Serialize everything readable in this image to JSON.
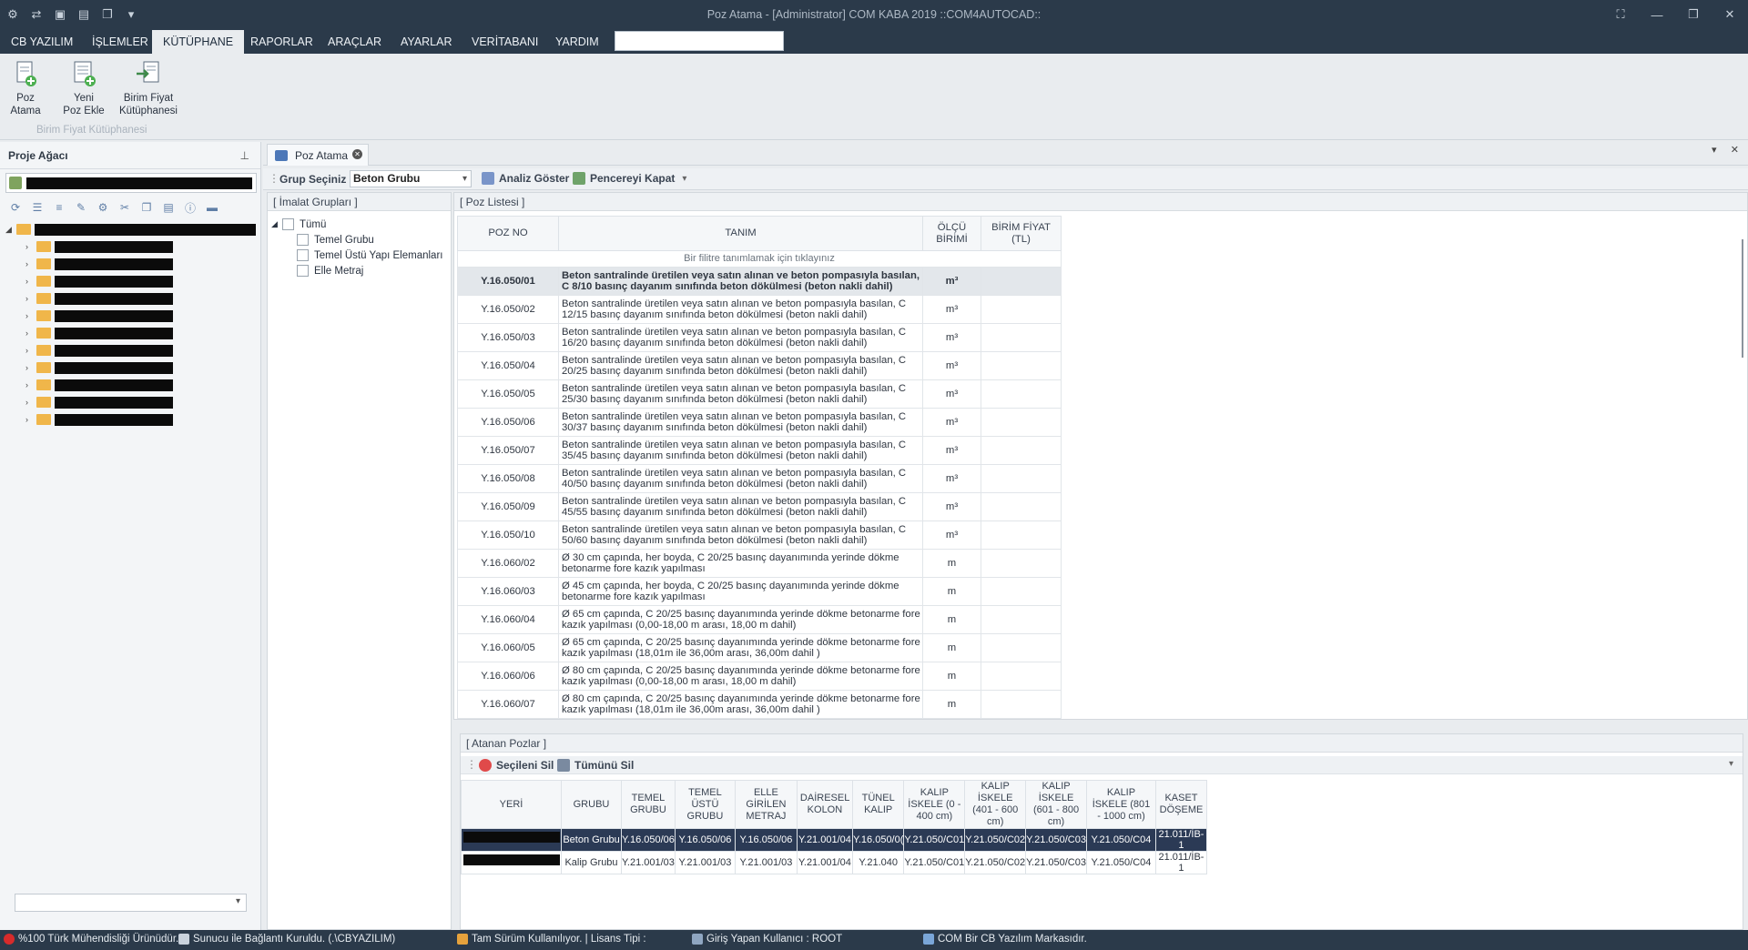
{
  "window": {
    "title": "Poz Atama - [Administrator] COM KABA 2019 ::COM4AUTOCAD::",
    "controls": [
      "⛶",
      "—",
      "❐",
      "✕"
    ]
  },
  "menu": {
    "items": [
      "CB YAZILIM",
      "İŞLEMLER",
      "KÜTÜPHANE",
      "RAPORLAR",
      "ARAÇLAR",
      "AYARLAR",
      "VERİTABANI",
      "YARDIM"
    ],
    "active": "KÜTÜPHANE",
    "search_value": ""
  },
  "ribbon": {
    "buttons": [
      {
        "line1": "Poz",
        "line2": "Atama"
      },
      {
        "line1": "Yeni",
        "line2": "Poz Ekle"
      },
      {
        "line1": "Birim Fiyat",
        "line2": "Kütüphanesi"
      }
    ],
    "group_caption": "Birim Fiyat Kütüphanesi"
  },
  "proje": {
    "title": "Proje Ağacı",
    "pin": "⊥"
  },
  "doc_tab": {
    "label": "Poz Atama",
    "close": "✕"
  },
  "group_toolbar": {
    "label": "Grup Seçiniz",
    "selected": "Beton Grubu",
    "analiz_label": "Analiz Göster",
    "kapat_label": "Pencereyi Kapat"
  },
  "imalat": {
    "title": "[ İmalat Grupları ]",
    "root": "Tümü",
    "items": [
      "Temel Grubu",
      "Temel Üstü Yapı Elemanları",
      "Elle Metraj"
    ]
  },
  "poz_list": {
    "title": "[ Poz Listesi ]",
    "headers": {
      "no": "POZ NO",
      "tanim": "TANIM",
      "birim": "ÖLÇÜ BİRİMİ",
      "fiyat": "BİRİM FİYAT (TL)"
    },
    "filter_hint": "Bir filitre tanımlamak için tıklayınız",
    "rows": [
      {
        "no": "Y.16.050/01",
        "tanim": "Beton santralinde üretilen veya satın alınan ve beton pompasıyla basılan, C 8/10 basınç dayanım sınıfında beton dökülmesi (beton nakli dahil)",
        "birim": "m³",
        "fiyat": ""
      },
      {
        "no": "Y.16.050/02",
        "tanim": "Beton santralinde üretilen veya satın alınan ve beton pompasıyla basılan, C 12/15 basınç dayanım sınıfında beton dökülmesi (beton nakli dahil)",
        "birim": "m³",
        "fiyat": ""
      },
      {
        "no": "Y.16.050/03",
        "tanim": "Beton santralinde üretilen veya satın alınan ve beton pompasıyla basılan, C 16/20 basınç dayanım sınıfında beton dökülmesi (beton nakli dahil)",
        "birim": "m³",
        "fiyat": ""
      },
      {
        "no": "Y.16.050/04",
        "tanim": "Beton santralinde üretilen veya satın alınan ve beton pompasıyla basılan, C 20/25 basınç dayanım sınıfında beton dökülmesi (beton nakli dahil)",
        "birim": "m³",
        "fiyat": ""
      },
      {
        "no": "Y.16.050/05",
        "tanim": "Beton santralinde üretilen veya satın alınan ve beton pompasıyla basılan, C 25/30 basınç dayanım sınıfında beton dökülmesi (beton nakli dahil)",
        "birim": "m³",
        "fiyat": ""
      },
      {
        "no": "Y.16.050/06",
        "tanim": "Beton santralinde üretilen veya satın alınan ve beton pompasıyla basılan, C 30/37 basınç dayanım sınıfında beton dökülmesi (beton nakli dahil)",
        "birim": "m³",
        "fiyat": ""
      },
      {
        "no": "Y.16.050/07",
        "tanim": "Beton santralinde üretilen veya satın alınan ve beton pompasıyla basılan, C 35/45 basınç dayanım sınıfında beton dökülmesi (beton nakli dahil)",
        "birim": "m³",
        "fiyat": ""
      },
      {
        "no": "Y.16.050/08",
        "tanim": "Beton santralinde üretilen veya satın alınan ve beton pompasıyla basılan, C 40/50 basınç dayanım sınıfında beton dökülmesi (beton nakli dahil)",
        "birim": "m³",
        "fiyat": ""
      },
      {
        "no": "Y.16.050/09",
        "tanim": "Beton santralinde üretilen veya satın alınan ve beton pompasıyla basılan, C 45/55 basınç dayanım sınıfında beton dökülmesi (beton nakli dahil)",
        "birim": "m³",
        "fiyat": ""
      },
      {
        "no": "Y.16.050/10",
        "tanim": "Beton santralinde üretilen veya satın alınan ve beton pompasıyla basılan, C 50/60 basınç dayanım sınıfında beton dökülmesi (beton nakli dahil)",
        "birim": "m³",
        "fiyat": ""
      },
      {
        "no": "Y.16.060/02",
        "tanim": "Ø 30 cm çapında, her boyda, C 20/25 basınç dayanımında yerinde dökme betonarme fore kazık yapılması",
        "birim": "m",
        "fiyat": ""
      },
      {
        "no": "Y.16.060/03",
        "tanim": "Ø 45 cm çapında, her boyda, C 20/25 basınç dayanımında yerinde dökme betonarme fore kazık yapılması",
        "birim": "m",
        "fiyat": ""
      },
      {
        "no": "Y.16.060/04",
        "tanim": "Ø 65 cm çapında, C 20/25 basınç dayanımında yerinde dökme betonarme fore kazık yapılması (0,00-18,00 m arası, 18,00 m dahil)",
        "birim": "m",
        "fiyat": ""
      },
      {
        "no": "Y.16.060/05",
        "tanim": "Ø 65 cm çapında, C 20/25 basınç dayanımında yerinde dökme betonarme fore kazık yapılması (18,01m ile 36,00m arası, 36,00m dahil )",
        "birim": "m",
        "fiyat": ""
      },
      {
        "no": "Y.16.060/06",
        "tanim": "Ø 80 cm çapında, C 20/25 basınç dayanımında yerinde dökme betonarme fore kazık yapılması (0,00-18,00 m arası, 18,00 m dahil)",
        "birim": "m",
        "fiyat": ""
      },
      {
        "no": "Y.16.060/07",
        "tanim": "Ø 80 cm çapında, C 20/25 basınç dayanımında yerinde dökme betonarme fore kazık yapılması (18,01m ile 36,00m arası, 36,00m dahil )",
        "birim": "m",
        "fiyat": ""
      }
    ]
  },
  "atanan": {
    "title": "[ Atanan Pozlar ]",
    "sil_label": "Seçileni Sil",
    "tumunu_label": "Tümünü Sil",
    "headers": [
      "YERİ",
      "GRUBU",
      "TEMEL GRUBU",
      "TEMEL ÜSTÜ GRUBU",
      "ELLE GİRİLEN METRAJ",
      "DAİRESEL KOLON",
      "TÜNEL KALIP",
      "KALIP İSKELE (0 - 400 cm)",
      "KALIP İSKELE (401 - 600 cm)",
      "KALIP İSKELE (601 - 800 cm)",
      "KALIP İSKELE (801 - 1000 cm)",
      "KASET DÖŞEME"
    ],
    "rows": [
      [
        "",
        "Beton Grubu",
        "Y.16.050/06",
        "Y.16.050/06",
        "Y.16.050/06",
        "Y.21.001/04",
        "Y.16.050/0(",
        "Y.21.050/C01",
        "Y.21.050/C02",
        "Y.21.050/C03",
        "Y.21.050/C04",
        "21.011/İB-1"
      ],
      [
        "",
        "Kalip Grubu",
        "Y.21.001/03",
        "Y.21.001/03",
        "Y.21.001/03",
        "Y.21.001/04",
        "Y.21.040",
        "Y.21.050/C01",
        "Y.21.050/C02",
        "Y.21.050/C03",
        "Y.21.050/C04",
        "21.011/İB-1"
      ]
    ]
  },
  "status": {
    "s1": "%100 Türk Mühendisliği Ürünüdür.",
    "s2": "Sunucu ile Bağlantı Kuruldu. (.\\CBYAZILIM)",
    "s3": "Tam Sürüm Kullanılıyor. | Lisans Tipi :",
    "s4": "Giriş Yapan Kullanıcı : ROOT",
    "s5": "COM Bir CB Yazılım Markasıdır."
  },
  "colors": {
    "titlebar": "#2b3a4a",
    "selected_row": "#2b3a55",
    "folder": "#f0b64a"
  }
}
